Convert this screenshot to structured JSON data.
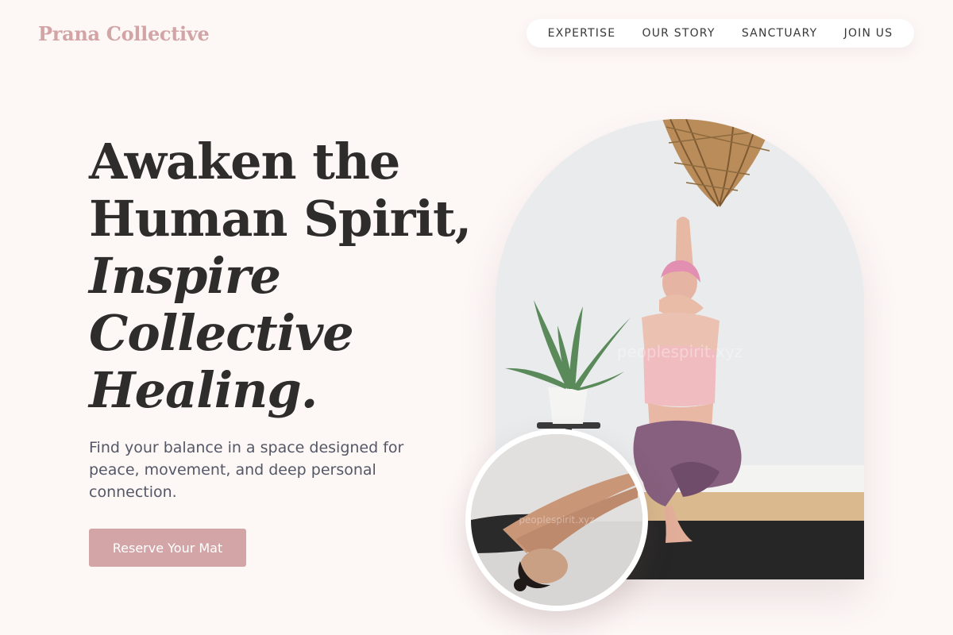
{
  "brand": {
    "name": "Prana Collective"
  },
  "nav": {
    "items": [
      {
        "label": "EXPERTISE"
      },
      {
        "label": "OUR STORY"
      },
      {
        "label": "SANCTUARY"
      },
      {
        "label": "JOIN US"
      }
    ]
  },
  "hero": {
    "headline_lines": [
      "Awaken the",
      "Human Spirit,"
    ],
    "headline_italic_lines": [
      "Inspire",
      "Collective",
      "Healing."
    ],
    "subtitle": "Find your balance in a space designed for peace, movement, and deep personal connection.",
    "cta_label": "Reserve Your Mat"
  },
  "images": {
    "main_watermark": "peoplespirit.xyz",
    "inset_watermark": "peoplespirit.xyz"
  },
  "colors": {
    "background": "#fdf7f6",
    "accent": "#d4a5a6",
    "text": "#2f2d2c",
    "muted_text": "#545866"
  }
}
